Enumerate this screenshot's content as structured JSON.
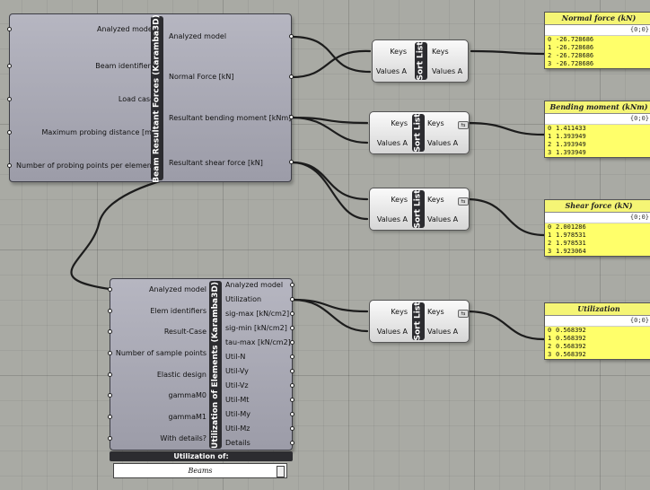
{
  "beam_component": {
    "title": "Beam Resultant Forces (Karamba3D)",
    "inputs": [
      "Analyzed model",
      "Beam identifiers",
      "Load case",
      "Maximum probing distance [m]",
      "Number of probing points per element"
    ],
    "outputs": [
      "Analyzed model",
      "Normal Force [kN]",
      "Resultant bending moment [kNm]",
      "Resultant shear force [kN]"
    ]
  },
  "util_component": {
    "title": "Utilization of Elements (Karamba3D)",
    "inputs": [
      "Analyzed model",
      "Elem identifiers",
      "Result-Case",
      "Number of sample points",
      "Elastic design",
      "gammaM0",
      "gammaM1",
      "With details?"
    ],
    "outputs": [
      "Analyzed model",
      "Utilization",
      "sig-max [kN/cm2]",
      "sig-min [kN/cm2]",
      "tau-max [kN/cm2]",
      "Util-N",
      "Util-Vy",
      "Util-Vz",
      "Util-Mt",
      "Util-My",
      "Util-Mz",
      "Details"
    ],
    "value_list_header": "Utilization of:",
    "value_list_value": "Beams"
  },
  "sort_lists": [
    {
      "title": "Sort List",
      "in_keys": "Keys",
      "in_values": "Values A",
      "out_keys": "Keys",
      "out_values": "Values A"
    },
    {
      "title": "Sort List",
      "in_keys": "Keys",
      "in_values": "Values A",
      "out_keys": "Keys",
      "out_values": "Values A"
    },
    {
      "title": "Sort List",
      "in_keys": "Keys",
      "in_values": "Values A",
      "out_keys": "Keys",
      "out_values": "Values A"
    },
    {
      "title": "Sort List",
      "in_keys": "Keys",
      "in_values": "Values A",
      "out_keys": "Keys",
      "out_values": "Values A"
    }
  ],
  "panels": [
    {
      "title": "Normal force (kN)",
      "path": "{0;0}",
      "rows": [
        {
          "i": "0",
          "v": "-26.728686"
        },
        {
          "i": "1",
          "v": "-26.728686"
        },
        {
          "i": "2",
          "v": "-26.728686"
        },
        {
          "i": "3",
          "v": "-26.728686"
        }
      ]
    },
    {
      "title": "Bending moment (kNm)",
      "path": "{0;0}",
      "rows": [
        {
          "i": "0",
          "v": "1.411433"
        },
        {
          "i": "1",
          "v": "1.393949"
        },
        {
          "i": "2",
          "v": "1.393949"
        },
        {
          "i": "3",
          "v": "1.393949"
        }
      ]
    },
    {
      "title": "Shear force (kN)",
      "path": "{0;0}",
      "rows": [
        {
          "i": "0",
          "v": "2.001286"
        },
        {
          "i": "1",
          "v": "1.978531"
        },
        {
          "i": "2",
          "v": "1.978531"
        },
        {
          "i": "3",
          "v": "1.923064"
        }
      ]
    },
    {
      "title": "Utilization",
      "path": "{0;0}",
      "rows": [
        {
          "i": "0",
          "v": "0.568392"
        },
        {
          "i": "1",
          "v": "0.568392"
        },
        {
          "i": "2",
          "v": "0.568392"
        },
        {
          "i": "3",
          "v": "0.568392"
        }
      ]
    }
  ]
}
